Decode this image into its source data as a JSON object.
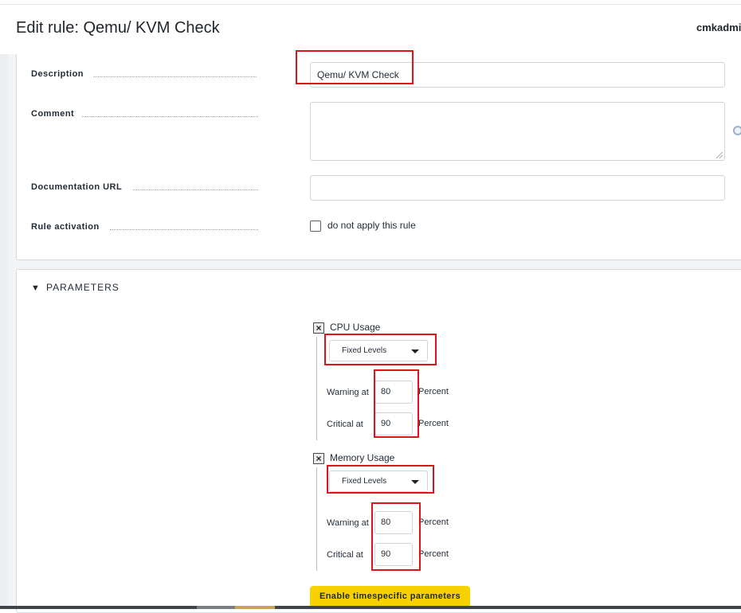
{
  "header": {
    "title": "Edit rule: Qemu/ KVM Check",
    "user": "cmkadmi"
  },
  "properties": {
    "description_label": "Description",
    "description_value": "Qemu/ KVM Check",
    "comment_label": "Comment",
    "comment_value": "",
    "doc_url_label": "Documentation URL",
    "doc_url_value": "",
    "activation_label": "Rule activation",
    "activation_checkbox_label": "do not apply this rule",
    "activation_checked": false
  },
  "parameters": {
    "section_title": "PARAMETERS",
    "cpu": {
      "label": "CPU Usage",
      "mode": "Fixed Levels",
      "warning_label": "Warning at",
      "warning_value": "80",
      "critical_label": "Critical at",
      "critical_value": "90",
      "unit": "Percent"
    },
    "memory": {
      "label": "Memory Usage",
      "mode": "Fixed Levels",
      "warning_label": "Warning at",
      "warning_value": "80",
      "critical_label": "Critical at",
      "critical_value": "90",
      "unit": "Percent"
    },
    "timespecific_button": "Enable timespecific parameters"
  },
  "colors": {
    "highlight": "#e0121a",
    "button_yellow": "#f7d100"
  }
}
